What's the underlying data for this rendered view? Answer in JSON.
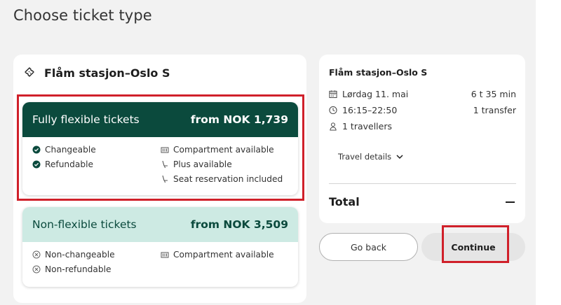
{
  "page": {
    "heading": "Choose ticket type"
  },
  "route": {
    "label": "Flåm stasjon–Oslo S",
    "icon": "ticket-icon"
  },
  "tickets": [
    {
      "name": "Fully flexible tickets",
      "price": "from NOK 1,739",
      "features_left": [
        "Changeable",
        "Refundable"
      ],
      "features_right": [
        "Compartment available",
        "Plus available",
        "Seat reservation included"
      ]
    },
    {
      "name": "Non-flexible tickets",
      "price": "from NOK 3,509",
      "features_left": [
        "Non-changeable",
        "Non-refundable"
      ],
      "features_right": [
        "Compartment available"
      ]
    }
  ],
  "summary": {
    "title": "Flåm stasjon–Oslo S",
    "date": "Lørdag 11. mai",
    "duration": "6 t 35 min",
    "time": "16:15–22:50",
    "transfers": "1 transfer",
    "travellers": "1 travellers",
    "details_label": "Travel details",
    "total_label": "Total"
  },
  "buttons": {
    "back": "Go back",
    "continue": "Continue"
  },
  "colors": {
    "flex_header": "#0b4a3d",
    "nonflex_header": "#cdeae3",
    "highlight": "#d0202a"
  }
}
